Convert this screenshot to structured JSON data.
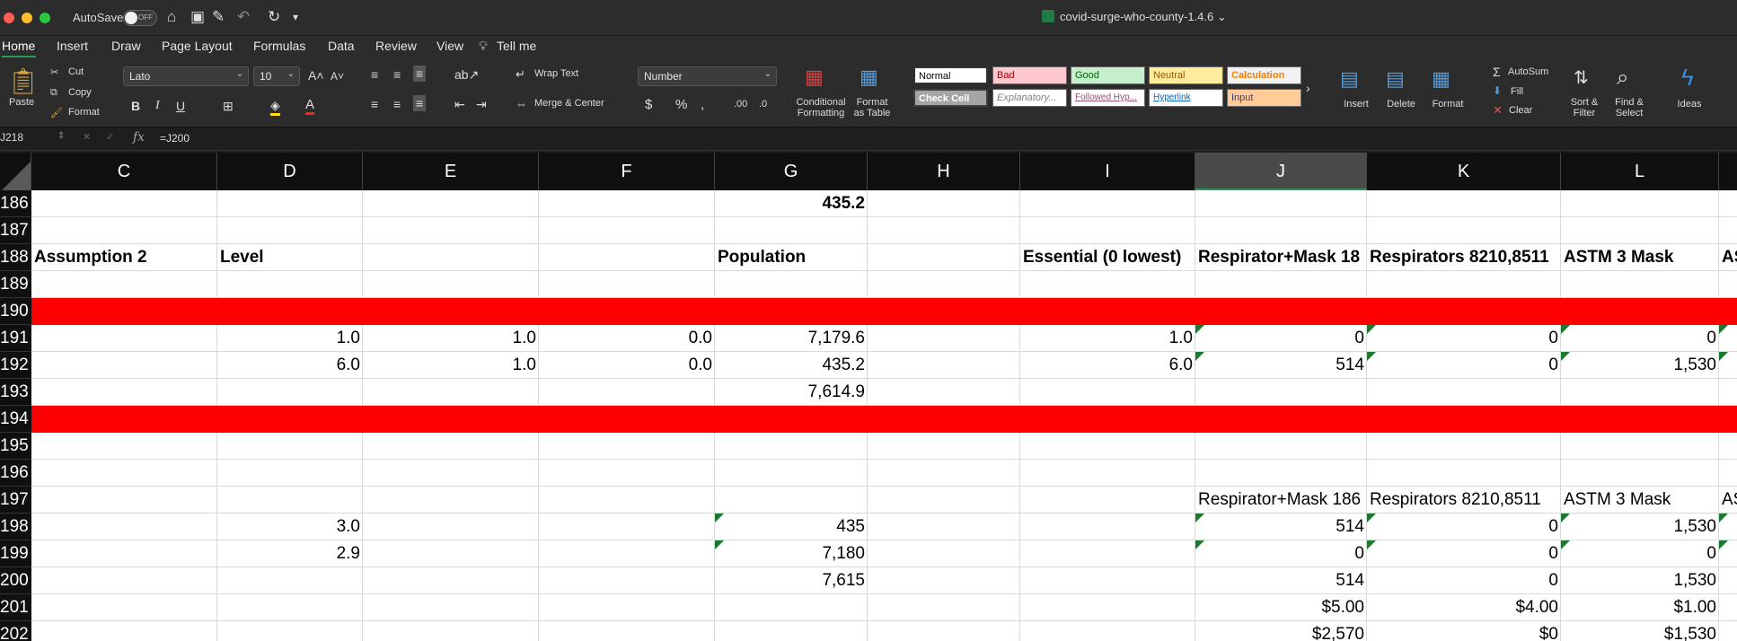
{
  "titlebar": {
    "autosave_label": "AutoSave",
    "autosave_state": "OFF",
    "document_title": "covid-surge-who-county-1.4.6"
  },
  "menu": {
    "tabs": [
      "Home",
      "Insert",
      "Draw",
      "Page Layout",
      "Formulas",
      "Data",
      "Review",
      "View",
      "Tell me"
    ]
  },
  "ribbon": {
    "paste": "Paste",
    "cut": "Cut",
    "copy": "Copy",
    "format_painter": "Format",
    "font_name": "Lato",
    "font_size": "10",
    "wrap_text": "Wrap Text",
    "merge_center": "Merge & Center",
    "number_format": "Number",
    "conditional_formatting": [
      "Conditional",
      "Formatting"
    ],
    "format_as_table": [
      "Format",
      "as Table"
    ],
    "styles": {
      "normal": "Normal",
      "bad": "Bad",
      "good": "Good",
      "neutral": "Neutral",
      "calculation": "Calculation",
      "check_cell": "Check Cell",
      "explanatory": "Explanatory...",
      "followed_hyperlink": "Followed Hyp...",
      "hyperlink": "Hyperlink",
      "input": "Input"
    },
    "insert": "Insert",
    "delete": "Delete",
    "format": "Format",
    "autosum": "AutoSum",
    "fill": "Fill",
    "clear": "Clear",
    "sort_filter": [
      "Sort &",
      "Filter"
    ],
    "find_select": [
      "Find &",
      "Select"
    ],
    "ideas": "Ideas"
  },
  "formula_bar": {
    "cell_ref": "J218",
    "formula": "=J200"
  },
  "columns": [
    "C",
    "D",
    "E",
    "F",
    "G",
    "H",
    "I",
    "J",
    "K",
    "L",
    ""
  ],
  "selected_column": "J",
  "rows": [
    {
      "num": "186",
      "cells": {
        "G": "435.2"
      },
      "bold": [
        "G"
      ]
    },
    {
      "num": "187",
      "cells": {}
    },
    {
      "num": "188",
      "cells": {
        "C": "Assumption 2",
        "D": "Level",
        "G": "Population",
        "I": "Essential (0 lowest)",
        "J": "Respirator+Mask 18",
        "K": "Respirators 8210,8511",
        "L": "ASTM 3 Mask",
        "M": "AS"
      },
      "bold": [
        "C",
        "D",
        "G",
        "I",
        "J",
        "K",
        "L",
        "M"
      ]
    },
    {
      "num": "189",
      "cells": {}
    },
    {
      "num": "190",
      "cells": {},
      "red": true
    },
    {
      "num": "191",
      "cells": {
        "D": "1.0",
        "E": "1.0",
        "F": "0.0",
        "G": "7,179.6",
        "I": "1.0",
        "J": "0",
        "K": "0",
        "L": "0"
      }
    },
    {
      "num": "192",
      "cells": {
        "D": "6.0",
        "E": "1.0",
        "F": "0.0",
        "G": "435.2",
        "I": "6.0",
        "J": "514",
        "K": "0",
        "L": "1,530"
      }
    },
    {
      "num": "193",
      "cells": {
        "G": "7,614.9"
      }
    },
    {
      "num": "194",
      "cells": {},
      "red": true
    },
    {
      "num": "195",
      "cells": {}
    },
    {
      "num": "196",
      "cells": {}
    },
    {
      "num": "197",
      "cells": {
        "J": "Respirator+Mask 186",
        "K": "Respirators 8210,8511",
        "L": "ASTM 3 Mask",
        "M": "AS"
      }
    },
    {
      "num": "198",
      "cells": {
        "D": "3.0",
        "G": "435",
        "J": "514",
        "K": "0",
        "L": "1,530"
      }
    },
    {
      "num": "199",
      "cells": {
        "D": "2.9",
        "G": "7,180",
        "J": "0",
        "K": "0",
        "L": "0"
      }
    },
    {
      "num": "200",
      "cells": {
        "G": "7,615",
        "J": "514",
        "K": "0",
        "L": "1,530"
      }
    },
    {
      "num": "201",
      "cells": {
        "J": "$5.00",
        "K": "$4.00",
        "L": "$1.00"
      }
    },
    {
      "num": "202",
      "cells": {
        "J": "$2,570",
        "K": "$0",
        "L": "$1,530"
      }
    }
  ]
}
